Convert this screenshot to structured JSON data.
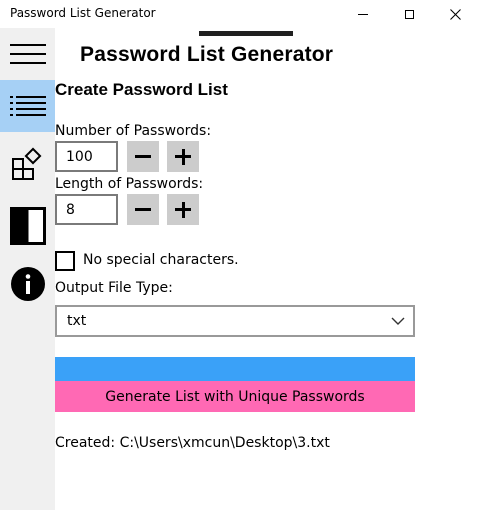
{
  "window": {
    "title": "Password List Generator"
  },
  "header": {
    "app_title": "Password List Generator"
  },
  "main": {
    "section_title": "Create Password List",
    "num_passwords_label": "Number of Passwords:",
    "num_passwords_value": "100",
    "length_label": "Length of Passwords:",
    "length_value": "8",
    "no_special_label": "No special characters.",
    "no_special_checked": false,
    "file_type_label": "Output File Type:",
    "file_type_selected": "txt",
    "generate_label": "Generate List with Unique Passwords",
    "status_text": "Created: C:\\Users\\xmcun\\Desktop\\3.txt"
  },
  "sidebar": {
    "items": [
      {
        "icon": "hamburger-menu-icon",
        "active": false
      },
      {
        "icon": "list-icon",
        "active": true
      },
      {
        "icon": "shapes-icon",
        "active": false
      },
      {
        "icon": "theme-contrast-icon",
        "active": false
      },
      {
        "icon": "info-icon",
        "active": false
      }
    ]
  },
  "colors": {
    "sidebar_bg": "#f0f0f0",
    "active_nav": "#a6d0f5",
    "blue_bar": "#3aa1f8",
    "generate_button": "#ff69b4",
    "stepper_bg": "#cccccc"
  }
}
